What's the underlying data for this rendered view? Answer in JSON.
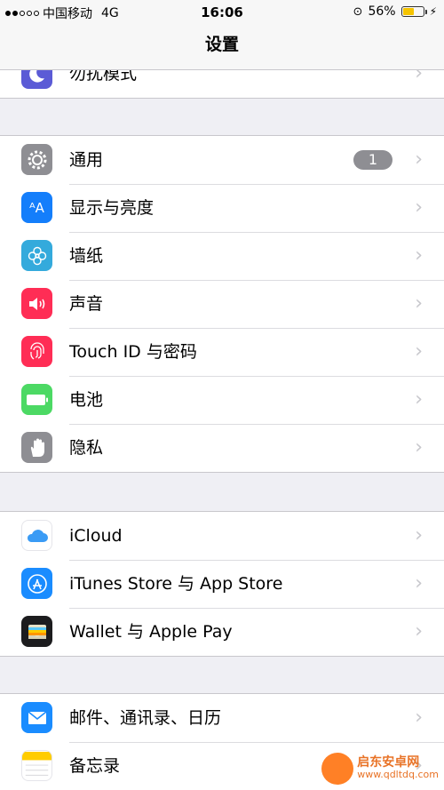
{
  "status": {
    "carrier": "中国移动",
    "network": "4G",
    "time": "16:06",
    "battery": "56%",
    "battery_level": 0.56,
    "signal_bars_filled": 2
  },
  "nav": {
    "title": "设置"
  },
  "groups": [
    {
      "items": [
        {
          "label": "勿扰模式",
          "icon": "moon-icon",
          "color": "#5b5bd6"
        }
      ]
    },
    {
      "items": [
        {
          "label": "通用",
          "icon": "gear-icon",
          "color": "#8e8e93",
          "badge": "1"
        },
        {
          "label": "显示与亮度",
          "icon": "text-size-icon",
          "color": "#147efb"
        },
        {
          "label": "墙纸",
          "icon": "flower-icon",
          "color": "#34aadc"
        },
        {
          "label": "声音",
          "icon": "speaker-icon",
          "color": "#ff2d55"
        },
        {
          "label": "Touch ID 与密码",
          "icon": "fingerprint-icon",
          "color": "#ff2d55"
        },
        {
          "label": "电池",
          "icon": "battery-icon",
          "color": "#4cd964"
        },
        {
          "label": "隐私",
          "icon": "hand-icon",
          "color": "#8e8e93"
        }
      ]
    },
    {
      "items": [
        {
          "label": "iCloud",
          "icon": "cloud-icon",
          "color": "#ffffff"
        },
        {
          "label": "iTunes Store 与 App Store",
          "icon": "app-store-icon",
          "color": "#1a8cff"
        },
        {
          "label": "Wallet 与 Apple Pay",
          "icon": "wallet-icon",
          "color": "#1c1c1e"
        }
      ]
    },
    {
      "items": [
        {
          "label": "邮件、通讯录、日历",
          "icon": "mail-icon",
          "color": "#1a8cff"
        },
        {
          "label": "备忘录",
          "icon": "notes-icon",
          "color": "#ffcc00"
        }
      ]
    }
  ],
  "watermark": {
    "line1": "启东安卓网",
    "line2": "www.qdltdq.com"
  }
}
